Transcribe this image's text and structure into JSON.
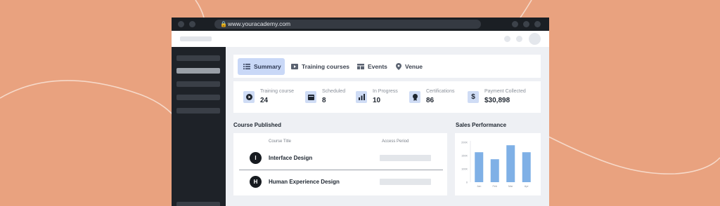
{
  "browser": {
    "url": "www.youracademy.com"
  },
  "tabs": [
    {
      "label": "Summary",
      "icon": "list-icon",
      "active": true
    },
    {
      "label": "Training courses",
      "icon": "video-icon",
      "active": false
    },
    {
      "label": "Events",
      "icon": "layout-icon",
      "active": false
    },
    {
      "label": "Venue",
      "icon": "location-pin-icon",
      "active": false
    }
  ],
  "stats": [
    {
      "label": "Training course",
      "value": "24",
      "icon": "play-icon"
    },
    {
      "label": "Scheduled",
      "value": "8",
      "icon": "calendar-icon"
    },
    {
      "label": "In Progress",
      "value": "10",
      "icon": "bar-chart-icon"
    },
    {
      "label": "Certifications",
      "value": "86",
      "icon": "certificate-icon"
    },
    {
      "label": "Payment Collected",
      "value": "$30,898",
      "icon": "dollar-icon"
    }
  ],
  "courses": {
    "title": "Course Published",
    "columns": [
      "Course Title",
      "Access Period"
    ],
    "rows": [
      {
        "initial": "I",
        "name": "Interface Design"
      },
      {
        "initial": "H",
        "name": "Human Experience Design"
      }
    ]
  },
  "sales": {
    "title": "Sales Performance"
  },
  "chart_data": {
    "type": "bar",
    "categories": [
      "Jan",
      "Feb",
      "Mar",
      "Apr"
    ],
    "values": [
      150,
      115,
      185,
      150
    ],
    "ylim": [
      0,
      200
    ],
    "yticks": [
      "200K",
      "150K",
      "100K",
      "0"
    ],
    "bar_color": "#7fb0e6",
    "title": "",
    "xlabel": "",
    "ylabel": ""
  },
  "colors": {
    "background": "#e9a27f",
    "sidebar": "#1e2228",
    "accent": "#c9d8f7"
  }
}
